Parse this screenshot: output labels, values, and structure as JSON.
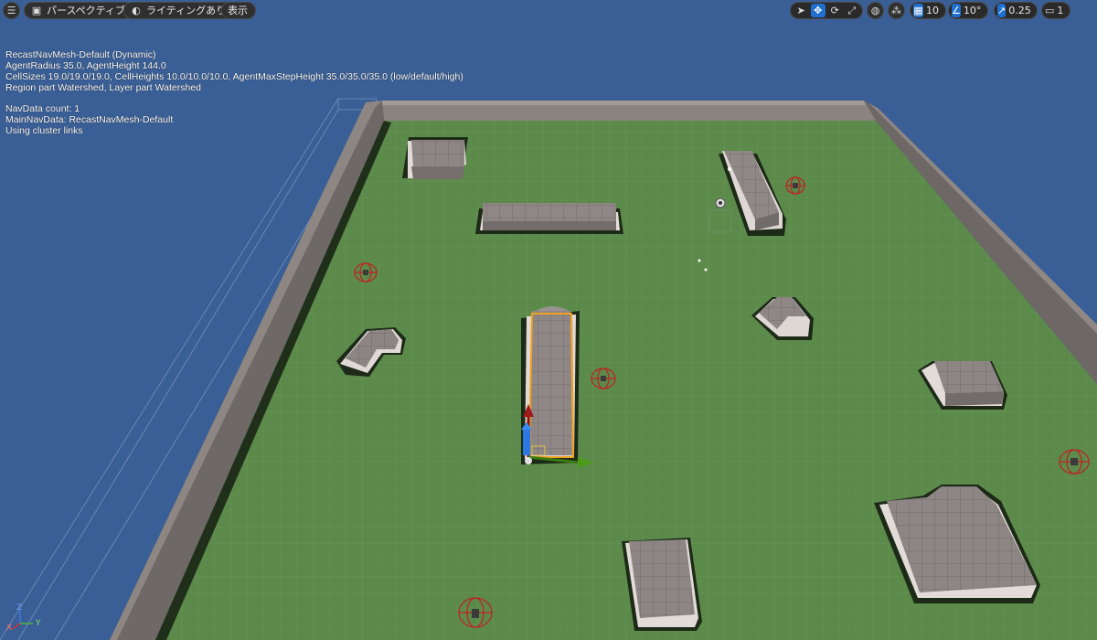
{
  "toolbar": {
    "menu_icon": "hamburger-menu-icon",
    "perspective_label": "パースペクティブ",
    "lighting_label": "ライティングあり",
    "show_label": "表示",
    "grid_snap_value": "10",
    "rotation_snap_value": "10°",
    "scale_snap_value": "0.25",
    "camera_speed_value": "1"
  },
  "overlay": {
    "lines_a": [
      "RecastNavMesh-Default (Dynamic)",
      "AgentRadius 35.0, AgentHeight 144.0",
      "CellSizes 19.0/19.0/19.0, CellHeights 10.0/10.0/10.0, AgentMaxStepHeight 35.0/35.0/35.0 (low/default/high)",
      "Region part Watershed, Layer part Watershed"
    ],
    "lines_b": [
      "NavData count: 1",
      "MainNavData: RecastNavMesh-Default",
      "Using cluster links"
    ]
  },
  "axes": {
    "z": "Z",
    "x": "X",
    "y": "Y"
  },
  "colors": {
    "sky": "#3a5f96",
    "navmesh_green": "#5c8a4a",
    "wall": "#7a7370",
    "block": "#8a8382",
    "selection": "#f0a020"
  }
}
